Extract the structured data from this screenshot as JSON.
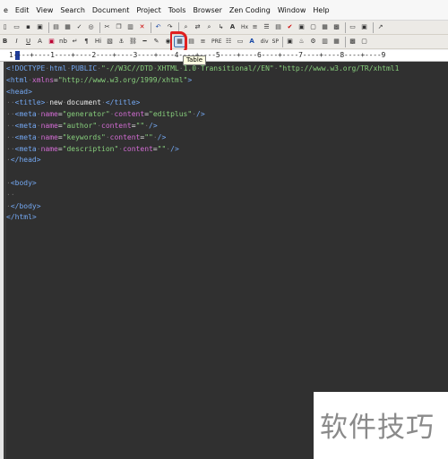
{
  "menu": [
    "e",
    "Edit",
    "View",
    "Search",
    "Document",
    "Project",
    "Tools",
    "Browser",
    "Zen Coding",
    "Window",
    "Help"
  ],
  "toolbar2": {
    "bold": "B",
    "italic": "I",
    "underline": "U",
    "pilcrow": "¶",
    "hi": "Hi",
    "pre": "PRE",
    "div": "div",
    "sp": "SP"
  },
  "ruler": {
    "text": "1----+----1----+----2----+----3----+----4----+----5----+----6----+----7----+----8----+----9"
  },
  "tooltip": "Table",
  "code": [
    [
      [
        "tag",
        "<!DOCTYPE"
      ],
      [
        "dot",
        "·"
      ],
      [
        "tag",
        "html"
      ],
      [
        "dot",
        "·"
      ],
      [
        "tag",
        "PUBLIC"
      ],
      [
        "dot",
        "·"
      ],
      [
        "str",
        "\"-//W3C//DTD"
      ],
      [
        "dot",
        "·"
      ],
      [
        "str",
        "XHTML"
      ],
      [
        "dot",
        "·"
      ],
      [
        "str",
        "1.0"
      ],
      [
        "dot",
        "·"
      ],
      [
        "str",
        "Transitional//EN\""
      ],
      [
        "dot",
        "·"
      ],
      [
        "str",
        "\"http://www.w3.org/TR/xhtml1"
      ]
    ],
    [
      [
        "tag",
        "<html"
      ],
      [
        "dot",
        "·"
      ],
      [
        "attr",
        "xmlns"
      ],
      [
        "txt",
        "="
      ],
      [
        "str",
        "\"http://www.w3.org/1999/xhtml\""
      ],
      [
        "tag",
        ">"
      ]
    ],
    [
      [
        "tag",
        "<head>"
      ]
    ],
    [
      [
        "dot",
        "··"
      ],
      [
        "tag",
        "<title>"
      ],
      [
        "dot",
        "·"
      ],
      [
        "txt",
        "new"
      ],
      [
        "dot",
        "·"
      ],
      [
        "txt",
        "document"
      ],
      [
        "dot",
        "·"
      ],
      [
        "tag",
        "</title>"
      ]
    ],
    [
      [
        "dot",
        "··"
      ],
      [
        "tag",
        "<meta"
      ],
      [
        "dot",
        "·"
      ],
      [
        "attr",
        "name"
      ],
      [
        "txt",
        "="
      ],
      [
        "str",
        "\"generator\""
      ],
      [
        "dot",
        "·"
      ],
      [
        "attr",
        "content"
      ],
      [
        "txt",
        "="
      ],
      [
        "str",
        "\"editplus\""
      ],
      [
        "dot",
        "·"
      ],
      [
        "tag",
        "/>"
      ]
    ],
    [
      [
        "dot",
        "··"
      ],
      [
        "tag",
        "<meta"
      ],
      [
        "dot",
        "·"
      ],
      [
        "attr",
        "name"
      ],
      [
        "txt",
        "="
      ],
      [
        "str",
        "\"author\""
      ],
      [
        "dot",
        "·"
      ],
      [
        "attr",
        "content"
      ],
      [
        "txt",
        "="
      ],
      [
        "str",
        "\"\""
      ],
      [
        "dot",
        "·"
      ],
      [
        "tag",
        "/>"
      ]
    ],
    [
      [
        "dot",
        "··"
      ],
      [
        "tag",
        "<meta"
      ],
      [
        "dot",
        "·"
      ],
      [
        "attr",
        "name"
      ],
      [
        "txt",
        "="
      ],
      [
        "str",
        "\"keywords\""
      ],
      [
        "dot",
        "·"
      ],
      [
        "attr",
        "content"
      ],
      [
        "txt",
        "="
      ],
      [
        "str",
        "\"\""
      ],
      [
        "dot",
        "·"
      ],
      [
        "tag",
        "/>"
      ]
    ],
    [
      [
        "dot",
        "··"
      ],
      [
        "tag",
        "<meta"
      ],
      [
        "dot",
        "·"
      ],
      [
        "attr",
        "name"
      ],
      [
        "txt",
        "="
      ],
      [
        "str",
        "\"description\""
      ],
      [
        "dot",
        "·"
      ],
      [
        "attr",
        "content"
      ],
      [
        "txt",
        "="
      ],
      [
        "str",
        "\"\""
      ],
      [
        "dot",
        "·"
      ],
      [
        "tag",
        "/>"
      ]
    ],
    [
      [
        "dot",
        "·"
      ],
      [
        "tag",
        "</head>"
      ]
    ],
    [],
    [
      [
        "dot",
        "·"
      ],
      [
        "tag",
        "<body>"
      ]
    ],
    [
      [
        "dot",
        "··"
      ]
    ],
    [
      [
        "dot",
        "·"
      ],
      [
        "tag",
        "</body>"
      ]
    ],
    [
      [
        "tag",
        "</html>"
      ]
    ]
  ],
  "watermark": "软件技巧"
}
